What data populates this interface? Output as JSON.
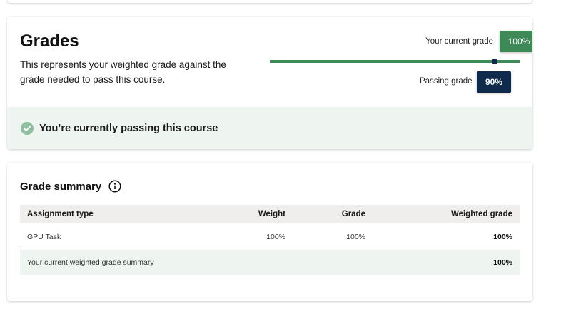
{
  "grades": {
    "title": "Grades",
    "description": "This represents your weighted grade against the grade needed to pass this course.",
    "current_grade_label": "Your current grade",
    "current_grade_value": "100%",
    "current_grade_fraction": 1.0,
    "passing_grade_label": "Passing grade",
    "passing_grade_value": "90%",
    "passing_grade_fraction": 0.9,
    "colors": {
      "current": "#3d8a57",
      "passing": "#0f2a4a",
      "banner_bg": "#eef5f1"
    },
    "status_message": "You’re currently passing this course",
    "status_icon": "check-circle-icon"
  },
  "summary": {
    "title": "Grade summary",
    "info_icon": "info-icon",
    "columns": [
      "Assignment type",
      "Weight",
      "Grade",
      "Weighted grade"
    ],
    "rows": [
      {
        "type": "GPU Task",
        "weight": "100%",
        "grade": "100%",
        "weighted": "100%"
      }
    ],
    "total": {
      "label": "Your current weighted grade summary",
      "weighted": "100%"
    }
  }
}
